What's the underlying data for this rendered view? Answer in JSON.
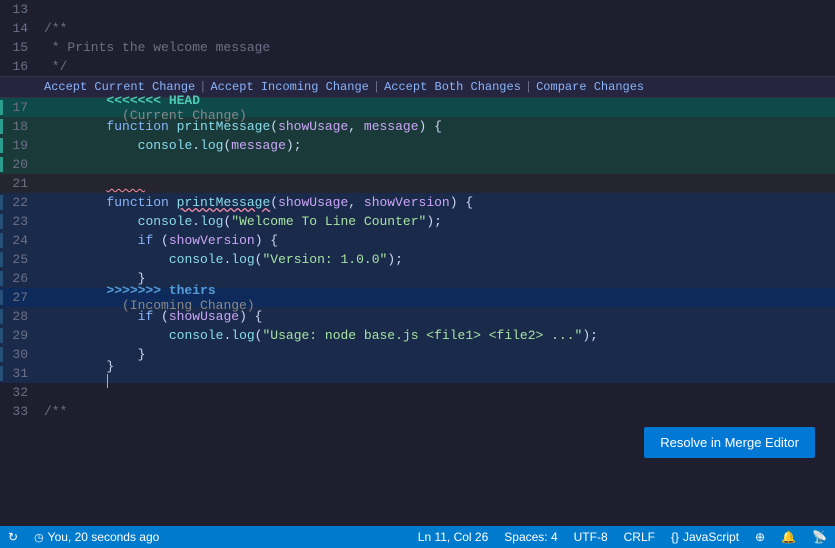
{
  "editor": {
    "lines": [
      {
        "num": "13",
        "type": "normal",
        "content": ""
      },
      {
        "num": "14",
        "type": "normal",
        "content": "/**"
      },
      {
        "num": "15",
        "type": "normal",
        "content": " * Prints the welcome message"
      },
      {
        "num": "16",
        "type": "normal",
        "content": " */"
      },
      {
        "num": "",
        "type": "action-bar",
        "content": ""
      },
      {
        "num": "17",
        "type": "current-header",
        "content": "<<<<<<< HEAD  (Current Change)"
      },
      {
        "num": "18",
        "type": "current",
        "content": "function printMessage(showUsage, message) {"
      },
      {
        "num": "19",
        "type": "current",
        "content": "    console.log(message);"
      },
      {
        "num": "20",
        "type": "current",
        "content": ""
      },
      {
        "num": "21",
        "type": "separator",
        "content": ""
      },
      {
        "num": "22",
        "type": "incoming-squiggly",
        "content": "function printMessage(showUsage, showVersion) {"
      },
      {
        "num": "23",
        "type": "incoming",
        "content": "    console.log(\"Welcome To Line Counter\");"
      },
      {
        "num": "24",
        "type": "incoming",
        "content": "    if (showVersion) {"
      },
      {
        "num": "25",
        "type": "incoming",
        "content": "        console.log(\"Version: 1.0.0\");"
      },
      {
        "num": "26",
        "type": "incoming",
        "content": "    }"
      },
      {
        "num": "27",
        "type": "incoming-header",
        "content": ">>>>>>> theirs  (Incoming Change)"
      },
      {
        "num": "28",
        "type": "incoming",
        "content": "    if (showUsage) {"
      },
      {
        "num": "29",
        "type": "incoming",
        "content": "        console.log(\"Usage: node base.js <file1> <file2> ...\");"
      },
      {
        "num": "30",
        "type": "incoming",
        "content": "    }"
      },
      {
        "num": "31",
        "type": "incoming",
        "content": "}"
      },
      {
        "num": "32",
        "type": "incoming",
        "content": ""
      },
      {
        "num": "33",
        "type": "normal",
        "content": "/**"
      }
    ],
    "action_bar": {
      "accept_current": "Accept Current Change",
      "sep1": "|",
      "accept_incoming": "Accept Incoming Change",
      "sep2": "|",
      "accept_both": "Accept Both Changes",
      "sep3": "|",
      "compare": "Compare Changes"
    }
  },
  "resolve_button": {
    "label": "Resolve in Merge Editor"
  },
  "status_bar": {
    "sync_icon": "↻",
    "git_info": "You, 20 seconds ago",
    "position": "Ln 11, Col 26",
    "spaces": "Spaces: 4",
    "encoding": "UTF-8",
    "line_ending": "CRLF",
    "language": "JavaScript",
    "remote_icon": "⊕",
    "bell_icon": "🔔",
    "broadcast_icon": "📡"
  }
}
